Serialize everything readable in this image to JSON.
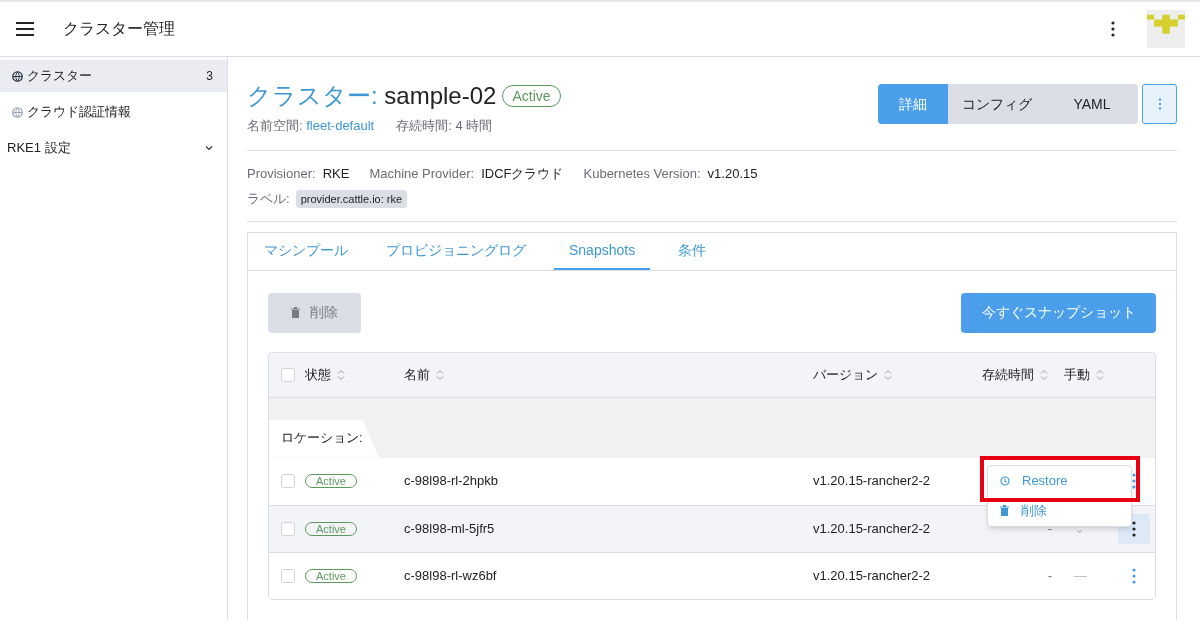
{
  "header": {
    "title": "クラスター管理"
  },
  "sidebar": {
    "items": [
      {
        "label": "クラスター",
        "count": "3",
        "selected": true,
        "kind": "link"
      },
      {
        "label": "クラウド認証情報",
        "selected": false,
        "kind": "link"
      },
      {
        "label": "RKE1 設定",
        "selected": false,
        "kind": "group",
        "expanded": false
      }
    ]
  },
  "page": {
    "title_prefix": "クラスター:",
    "title_name": "sample-02",
    "status": "Active",
    "namespace_label": "名前空間:",
    "namespace": "fleet-default",
    "age_label": "存続時間:",
    "age": "4 時間",
    "view_tabs": [
      {
        "label": "詳細",
        "selected": true
      },
      {
        "label": "コンフィグ",
        "selected": false
      },
      {
        "label": "YAML",
        "selected": false
      }
    ],
    "info": [
      {
        "label": "Provisioner:",
        "value": "RKE"
      },
      {
        "label": "Machine Provider:",
        "value": "IDCFクラウド"
      },
      {
        "label": "Kubernetes Version:",
        "value": "v1.20.15"
      }
    ],
    "labels_label": "ラベル:",
    "labels": [
      "provider.cattle.io: rke"
    ]
  },
  "tabs": [
    {
      "label": "マシンプール",
      "selected": false
    },
    {
      "label": "プロビジョニングログ",
      "selected": false
    },
    {
      "label": "Snapshots",
      "selected": true
    },
    {
      "label": "条件",
      "selected": false
    }
  ],
  "toolbar": {
    "delete_button": {
      "label": "削除",
      "disabled": true
    },
    "snapshot_button": "今すぐスナップショット"
  },
  "table": {
    "select_all_checked": false,
    "columns": [
      "状態",
      "名前",
      "バージョン",
      "存続時間",
      "手動"
    ],
    "group_label": "ロケーション:",
    "rows": [
      {
        "checked": false,
        "state": "Active",
        "name": "c-98l98-rl-2hpkb",
        "version": "v1.20.15-rancher2-2",
        "hovered": false
      },
      {
        "checked": false,
        "state": "Active",
        "name": "c-98l98-ml-5jfr5",
        "version": "v1.20.15-rancher2-2",
        "age": "-",
        "manual": "⌄",
        "hovered": true
      },
      {
        "checked": false,
        "state": "Active",
        "name": "c-98l98-rl-wz6bf",
        "version": "v1.20.15-rancher2-2",
        "age": "-",
        "manual": "—",
        "hovered": false
      }
    ]
  },
  "action_menu": {
    "items": [
      {
        "label": "Restore",
        "kind": "restore",
        "highlighted": true
      },
      {
        "label": "削除",
        "kind": "delete",
        "highlighted": false
      }
    ]
  }
}
